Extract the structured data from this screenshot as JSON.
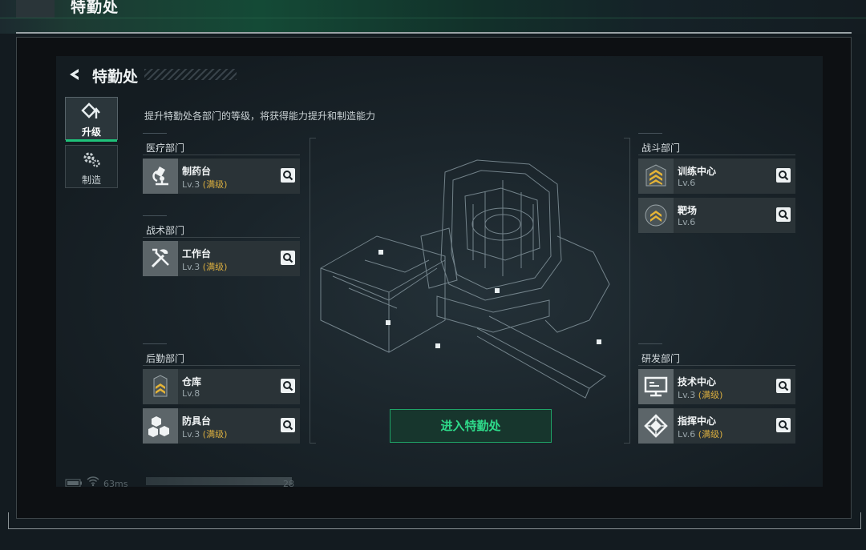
{
  "header": {
    "title": "特勤处"
  },
  "screen": {
    "title": "特勤处",
    "description": "提升特勤处各部门的等级，将获得能力提升和制造能力"
  },
  "side_tabs": [
    {
      "label": "升级",
      "icon": "upgrade-icon",
      "active": true
    },
    {
      "label": "制造",
      "icon": "gear-icon",
      "active": false
    }
  ],
  "departments": {
    "medical": {
      "title": "医疗部门",
      "items": [
        {
          "name": "制药台",
          "level": "Lv.3",
          "max": "(满级)",
          "icon": "microscope-icon"
        }
      ]
    },
    "tactical": {
      "title": "战术部门",
      "items": [
        {
          "name": "工作台",
          "level": "Lv.3",
          "max": "(满级)",
          "icon": "tools-icon"
        }
      ]
    },
    "logistics": {
      "title": "后勤部门",
      "items": [
        {
          "name": "仓库",
          "level": "Lv.8",
          "max": "",
          "icon": "rank-chevron-icon"
        },
        {
          "name": "防具台",
          "level": "Lv.3",
          "max": "(满级)",
          "icon": "boxes-icon"
        }
      ]
    },
    "combat": {
      "title": "战斗部门",
      "items": [
        {
          "name": "训练中心",
          "level": "Lv.6",
          "max": "",
          "icon": "rank-chevron-icon"
        },
        {
          "name": "靶场",
          "level": "Lv.6",
          "max": "",
          "icon": "rank-chevron-icon"
        }
      ]
    },
    "research": {
      "title": "研发部门",
      "items": [
        {
          "name": "技术中心",
          "level": "Lv.3",
          "max": "(满级)",
          "icon": "monitor-icon"
        },
        {
          "name": "指挥中心",
          "level": "Lv.6",
          "max": "(满级)",
          "icon": "chip-icon"
        }
      ]
    }
  },
  "enter_button": {
    "label": "进入特勤处"
  },
  "status_bar": {
    "ping": "63ms",
    "count": "28"
  },
  "colors": {
    "accent_green": "#2ed989",
    "max_gold": "#d9ad3f",
    "card_bg": "#2a3337"
  }
}
